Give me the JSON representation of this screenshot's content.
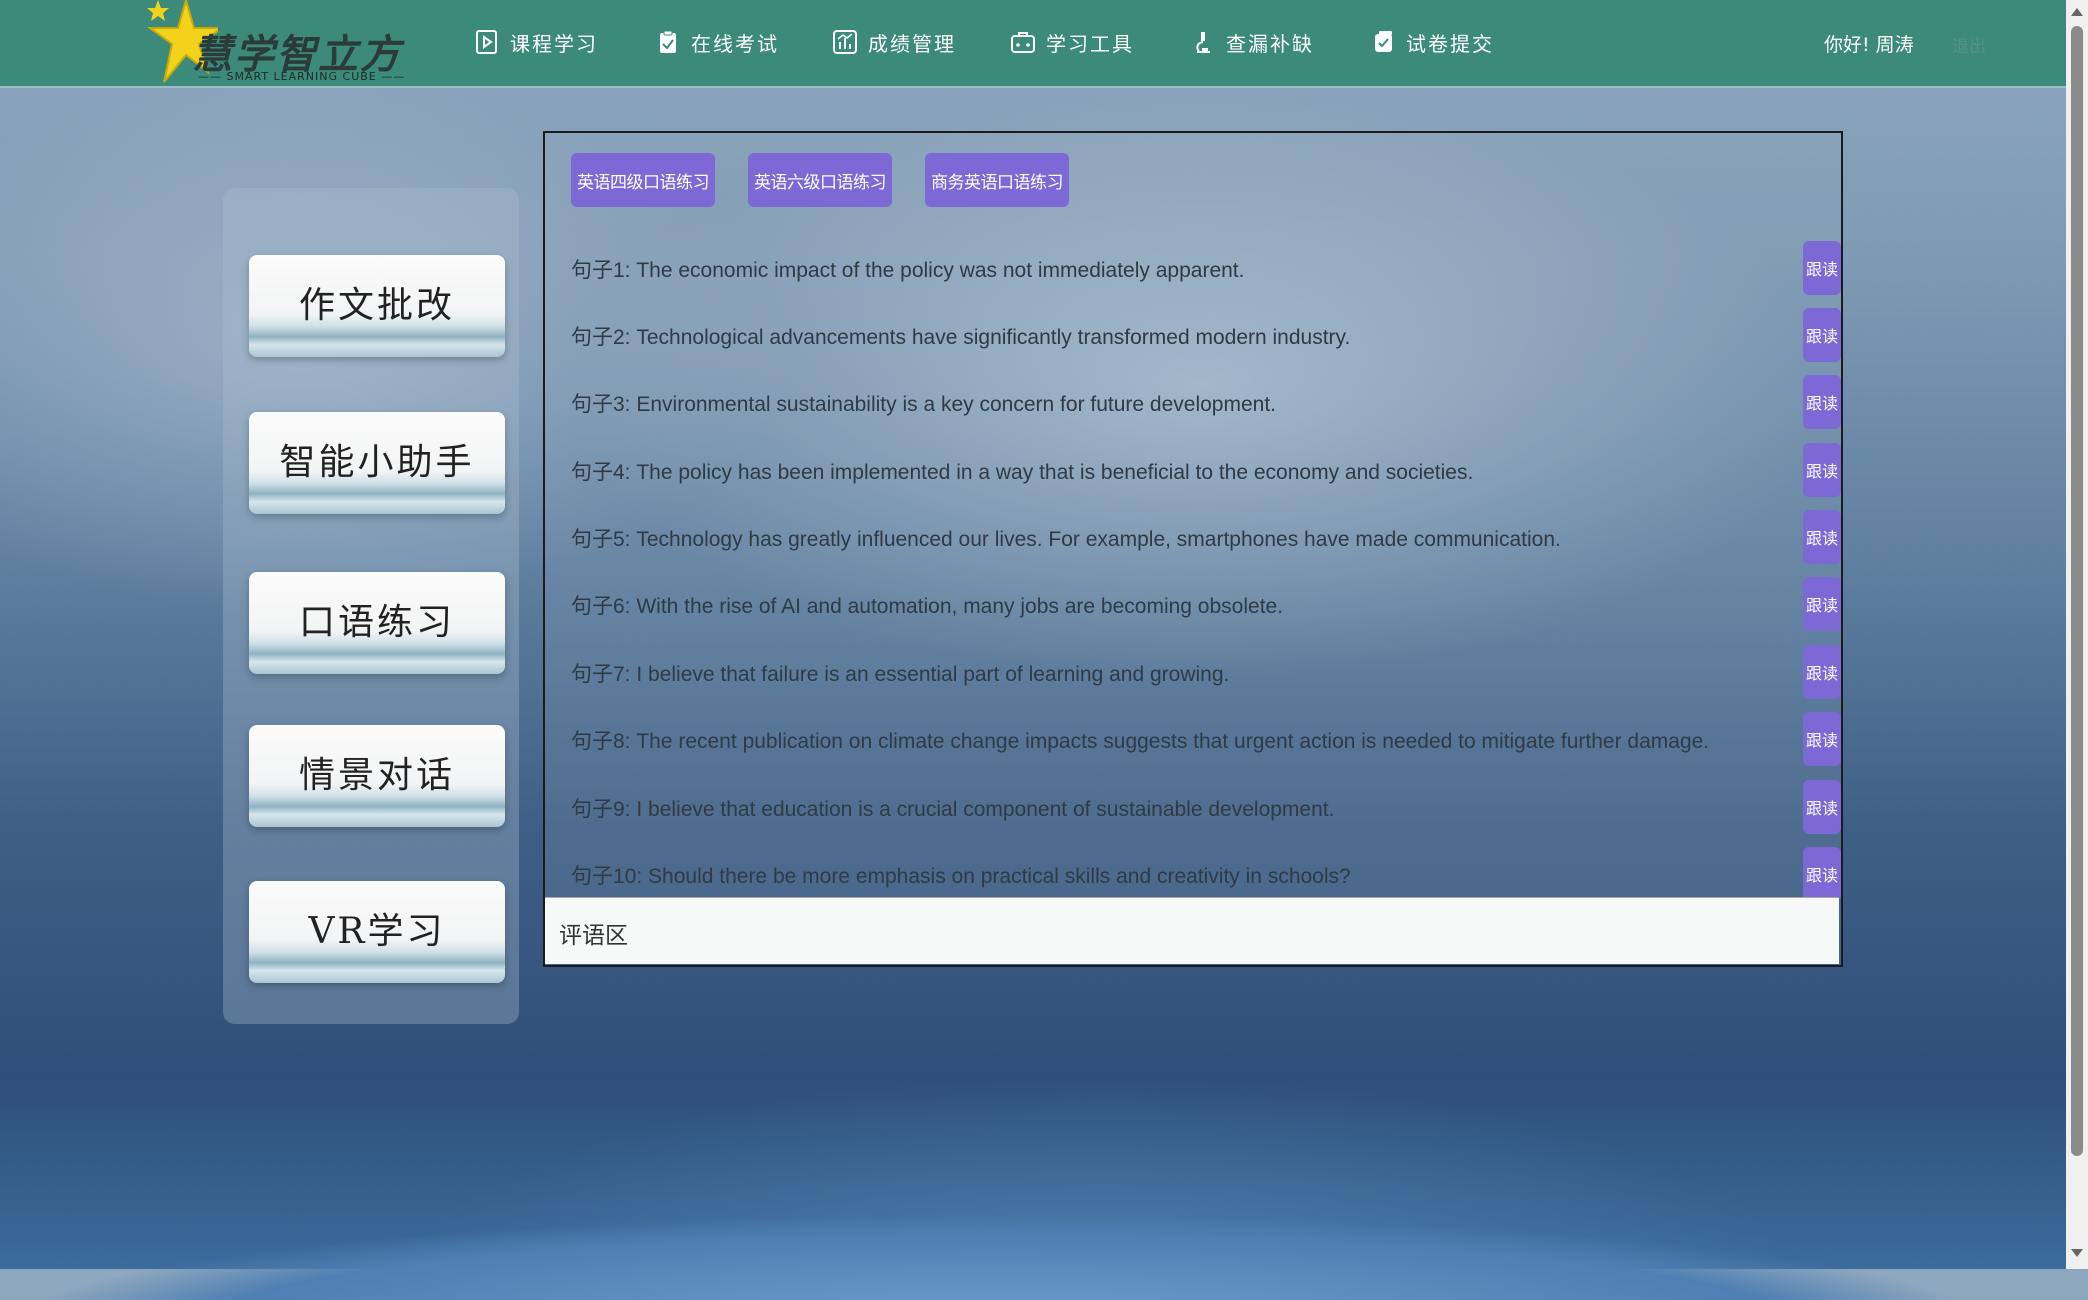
{
  "header": {
    "logo_text": "慧学智立方",
    "logo_subtext": "SMART LEARNING CUBE",
    "nav": [
      {
        "label": "课程学习",
        "icon": "course-play-icon"
      },
      {
        "label": "在线考试",
        "icon": "exam-clipboard-icon"
      },
      {
        "label": "成绩管理",
        "icon": "chart-icon"
      },
      {
        "label": "学习工具",
        "icon": "toolbox-icon"
      },
      {
        "label": "查漏补缺",
        "icon": "microscope-icon"
      },
      {
        "label": "试卷提交",
        "icon": "submit-icon"
      }
    ],
    "greeting": "你好! 周涛",
    "logout": "退出"
  },
  "sidebar": {
    "items": [
      {
        "label": "作文批改"
      },
      {
        "label": "智能小助手"
      },
      {
        "label": "口语练习"
      },
      {
        "label": "情景对话"
      },
      {
        "label": "VR学习"
      }
    ]
  },
  "main": {
    "tabs": [
      {
        "label": "英语四级口语练习"
      },
      {
        "label": "英语六级口语练习"
      },
      {
        "label": "商务英语口语练习"
      }
    ],
    "follow_label": "跟读",
    "sentences": [
      "句子1: The economic impact of the policy was not immediately apparent.",
      "句子2: Technological advancements have significantly transformed modern industry.",
      "句子3: Environmental sustainability is a key concern for future development.",
      "句子4: The policy has been implemented in a way that is beneficial to the economy and societies.",
      "句子5: Technology has greatly influenced our lives. For example, smartphones have made communication.",
      "句子6: With the rise of AI and automation, many jobs are becoming obsolete.",
      "句子7: I believe that failure is an essential part of learning and growing.",
      "句子8: The recent publication on climate change impacts suggests that urgent action is needed to mitigate further damage.",
      "句子9: I believe that education is a crucial component of sustainable development.",
      "句子10: Should there be more emphasis on practical skills and creativity in schools?"
    ],
    "comment_label": "评语区"
  },
  "colors": {
    "header_bg": "#3c8b7a",
    "button_purple": "#7c69d6",
    "logo_star": "#f2d21b"
  }
}
